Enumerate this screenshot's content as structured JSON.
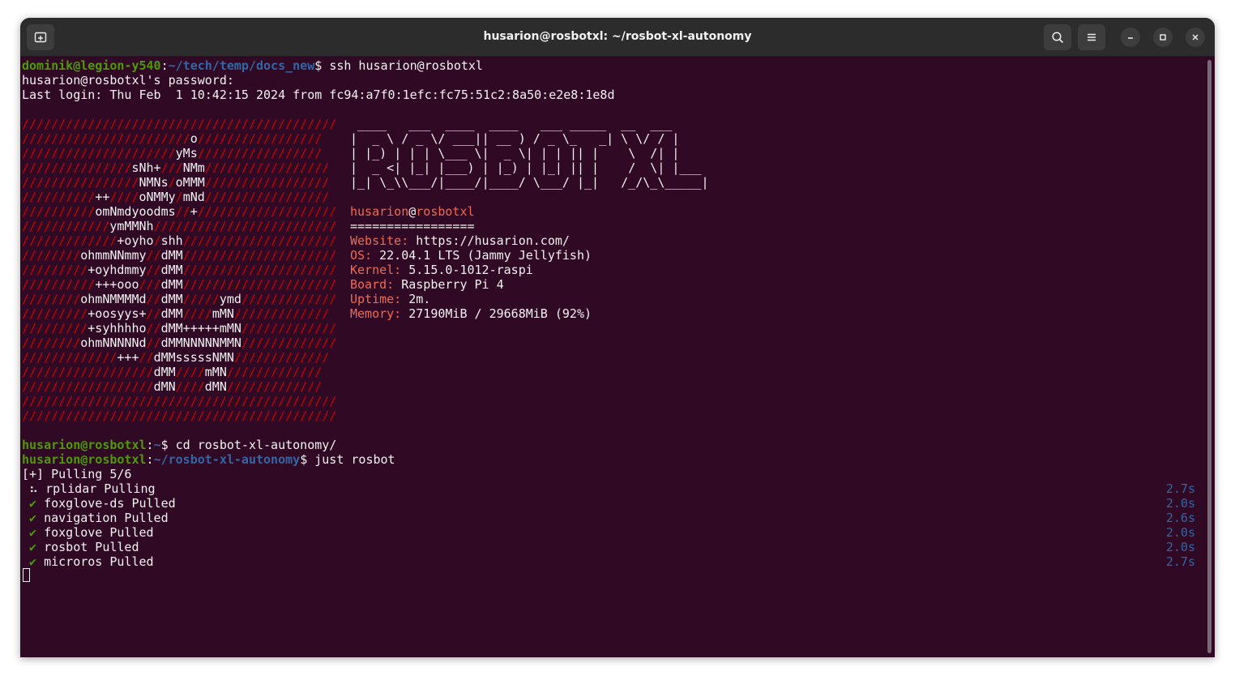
{
  "window": {
    "title": "husarion@rosbotxl: ~/rosbot-xl-autonomy"
  },
  "icons": {
    "new_tab": "new-tab-icon",
    "search": "search-icon",
    "menu": "hamburger-menu-icon",
    "minimize": "minimize-icon",
    "maximize": "maximize-icon",
    "close": "close-icon"
  },
  "colors": {
    "background": "#300a24",
    "prompt_user": "#4e9a06",
    "prompt_path": "#3465a4",
    "logo_red": "#cc0000",
    "info_label": "#ef6a52"
  },
  "session1": {
    "user_host": "dominik@legion-y540",
    "path": "~/tech/temp/docs_new",
    "command": "ssh husarion@rosbotxl",
    "password_prompt": "husarion@rosbotxl's password:",
    "last_login": "Last login: Thu Feb  1 10:42:15 2024 from fc94:a7f0:1efc:fc75:51c2:8a50:e2e8:1e8d"
  },
  "ascii_logo": [
    [
      [
        "s",
        "///////////////////////////////////////////"
      ]
    ],
    [
      [
        "s",
        "///////////////////////"
      ],
      [
        "w",
        "o"
      ],
      [
        "s",
        "/////////////////"
      ]
    ],
    [
      [
        "s",
        "/////////////////////"
      ],
      [
        "w",
        "yMs"
      ],
      [
        "s",
        "/////////////////"
      ]
    ],
    [
      [
        "s",
        "///////////////"
      ],
      [
        "w",
        "sNh+"
      ],
      [
        "s",
        "///"
      ],
      [
        "w",
        "NMm"
      ],
      [
        "s",
        "/////////////////"
      ]
    ],
    [
      [
        "s",
        "////////////////"
      ],
      [
        "w",
        "NMNs"
      ],
      [
        "s",
        "/"
      ],
      [
        "w",
        "oMMM"
      ],
      [
        "s",
        "/////////////////"
      ]
    ],
    [
      [
        "s",
        "//////////"
      ],
      [
        "w",
        "++"
      ],
      [
        "s",
        "////"
      ],
      [
        "w",
        "oNMMy"
      ],
      [
        "s",
        "/"
      ],
      [
        "w",
        "mNd"
      ],
      [
        "s",
        "/////////////////"
      ]
    ],
    [
      [
        "s",
        "//////////"
      ],
      [
        "w",
        "omNmdyoodms"
      ],
      [
        "s",
        "//"
      ],
      [
        "w",
        "+"
      ],
      [
        "s",
        "///////////////////"
      ]
    ],
    [
      [
        "s",
        "////////////"
      ],
      [
        "w",
        "ymMMNh"
      ],
      [
        "s",
        "/////////////////////////"
      ]
    ],
    [
      [
        "s",
        "/////////////"
      ],
      [
        "w",
        "+oyho"
      ],
      [
        "s",
        "/"
      ],
      [
        "w",
        "shh"
      ],
      [
        "s",
        "/////////////////////"
      ]
    ],
    [
      [
        "s",
        "////////"
      ],
      [
        "w",
        "ohmmNNmmy"
      ],
      [
        "s",
        "//"
      ],
      [
        "w",
        "dMM"
      ],
      [
        "s",
        "/////////////////////"
      ]
    ],
    [
      [
        "s",
        "/////////"
      ],
      [
        "w",
        "+oyhdmmy"
      ],
      [
        "s",
        "//"
      ],
      [
        "w",
        "dMM"
      ],
      [
        "s",
        "/////////////////////"
      ]
    ],
    [
      [
        "s",
        "//////////"
      ],
      [
        "w",
        "+++ooo"
      ],
      [
        "s",
        "///"
      ],
      [
        "w",
        "dMM"
      ],
      [
        "s",
        "/////////////////////"
      ]
    ],
    [
      [
        "s",
        "////////"
      ],
      [
        "w",
        "ohmNMMMMd"
      ],
      [
        "s",
        "//"
      ],
      [
        "w",
        "dMM"
      ],
      [
        "s",
        "/////"
      ],
      [
        "w",
        "ymd"
      ],
      [
        "s",
        "/////////////"
      ]
    ],
    [
      [
        "s",
        "/////////"
      ],
      [
        "w",
        "+oosyys+"
      ],
      [
        "s",
        "//"
      ],
      [
        "w",
        "dMM"
      ],
      [
        "s",
        "////"
      ],
      [
        "w",
        "mMN"
      ],
      [
        "s",
        "/////////////"
      ]
    ],
    [
      [
        "s",
        "/////////"
      ],
      [
        "w",
        "+syhhhho"
      ],
      [
        "s",
        "//"
      ],
      [
        "w",
        "dMM+++++mMN"
      ],
      [
        "s",
        "/////////////"
      ]
    ],
    [
      [
        "s",
        "////////"
      ],
      [
        "w",
        "ohmNNNNNd"
      ],
      [
        "s",
        "//"
      ],
      [
        "w",
        "dMMNNNNNMMN"
      ],
      [
        "s",
        "/////////////"
      ]
    ],
    [
      [
        "s",
        "/////////////"
      ],
      [
        "w",
        "+++"
      ],
      [
        "s",
        "//"
      ],
      [
        "w",
        "dMMsssssNMN"
      ],
      [
        "s",
        "/////////////"
      ]
    ],
    [
      [
        "s",
        "//////////////////"
      ],
      [
        "w",
        "dMM"
      ],
      [
        "s",
        "////"
      ],
      [
        "w",
        "mMN"
      ],
      [
        "s",
        "/////////////"
      ]
    ],
    [
      [
        "s",
        "//////////////////"
      ],
      [
        "w",
        "dMN"
      ],
      [
        "s",
        "////"
      ],
      [
        "w",
        "dMN"
      ],
      [
        "s",
        "/////////////"
      ]
    ],
    [
      [
        "s",
        "///////////////////////////////////////////"
      ]
    ],
    [
      [
        "s",
        "///////////////////////////////////////////"
      ]
    ]
  ],
  "banner": [
    "  ____   ___  ____  ____   ___ _____  __  ___",
    " |  _ \\ / _ \\/ ___|| __ ) / _ \\_   _| \\ \\/ / |",
    " | |_) | | | \\___ \\|  _ \\| | | || |    \\  /| |",
    " |  _ <| |_| |___) | |_) | |_| || |    /  \\| |___",
    " |_| \\_\\\\___/|____/|____/ \\___/ |_|   /_/\\_\\_____|"
  ],
  "info": {
    "user": "husarion",
    "at": "@",
    "host": "rosbotxl",
    "separator": "=================",
    "rows": [
      {
        "label": "Website:",
        "value": " https://husarion.com/"
      },
      {
        "label": "OS:",
        "value": " 22.04.1 LTS (Jammy Jellyfish)"
      },
      {
        "label": "Kernel:",
        "value": " 5.15.0-1012-raspi"
      },
      {
        "label": "Board:",
        "value": " Raspberry Pi 4"
      },
      {
        "label": "Uptime:",
        "value": " 2m."
      },
      {
        "label": "Memory:",
        "value": " 27190MiB / 29668MiB (92%)"
      }
    ]
  },
  "session2": {
    "user_host": "husarion@rosbotxl",
    "home_path": "~",
    "command1": "cd rosbot-xl-autonomy/",
    "path2": "~/rosbot-xl-autonomy",
    "command2": "just rosbot"
  },
  "pull": {
    "header": "[+] Pulling 5/6",
    "items": [
      {
        "status": "⠦",
        "name": "rplidar Pulling",
        "time": "2.7s",
        "done": false
      },
      {
        "status": "✔",
        "name": "foxglove-ds Pulled",
        "time": "2.0s",
        "done": true
      },
      {
        "status": "✔",
        "name": "navigation Pulled",
        "time": "2.6s",
        "done": true
      },
      {
        "status": "✔",
        "name": "foxglove Pulled",
        "time": "2.0s",
        "done": true
      },
      {
        "status": "✔",
        "name": "rosbot Pulled",
        "time": "2.0s",
        "done": true
      },
      {
        "status": "✔",
        "name": "microros Pulled",
        "time": "2.7s",
        "done": true
      }
    ]
  }
}
